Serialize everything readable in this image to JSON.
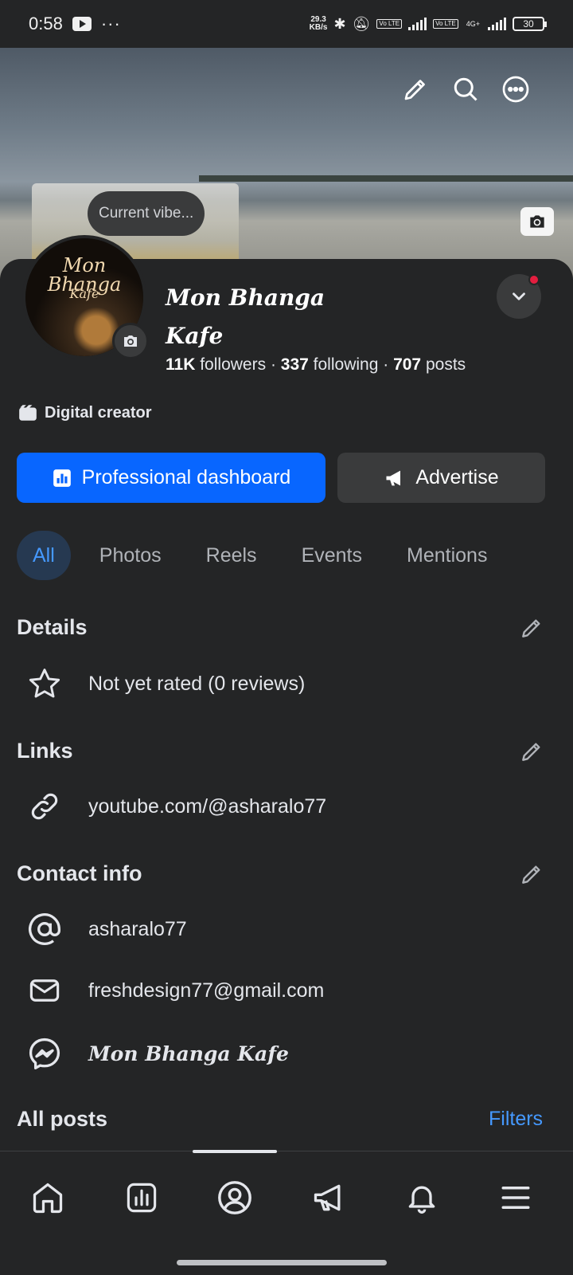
{
  "status_bar": {
    "time": "0:58",
    "dots": "···",
    "speed_top": "29.3",
    "speed_unit": "KB/s",
    "lte1": "Vo LTE",
    "lte2": "Vo LTE",
    "net": "4G+",
    "battery": "30"
  },
  "cover": {
    "vibe_label": "Current vibe...",
    "icons": [
      "pencil-icon",
      "search-icon",
      "more-icon",
      "camera-icon"
    ]
  },
  "profile": {
    "name_line1": "Mon Bhanga",
    "name_line2": "Kafe",
    "avatar_text1": "Mon Bhanga",
    "avatar_text2": "Kafe",
    "followers_count": "11K",
    "followers_label": "followers",
    "following_count": "337",
    "following_label": "following",
    "posts_count": "707",
    "posts_label": "posts",
    "separator": "·",
    "category": "Digital creator"
  },
  "actions": {
    "dashboard_label": "Professional dashboard",
    "advertise_label": "Advertise"
  },
  "tabs": [
    "All",
    "Photos",
    "Reels",
    "Events",
    "Mentions"
  ],
  "active_tab": "All",
  "details": {
    "title": "Details",
    "rating": "Not yet rated (0 reviews)"
  },
  "links": {
    "title": "Links",
    "url": "youtube.com/@asharalo77"
  },
  "contact": {
    "title": "Contact info",
    "handle": "asharalo77",
    "email": "freshdesign77@gmail.com",
    "messenger": "Mon Bhanga Kafe"
  },
  "posts": {
    "title": "All posts",
    "filters_label": "Filters"
  },
  "bottom_nav": [
    "home-icon",
    "dashboard-icon",
    "profile-icon",
    "megaphone-icon",
    "bell-icon",
    "menu-icon"
  ],
  "colors": {
    "background": "#242526",
    "accent": "#0866ff",
    "link": "#4599ff",
    "notification": "#e41e3f"
  }
}
